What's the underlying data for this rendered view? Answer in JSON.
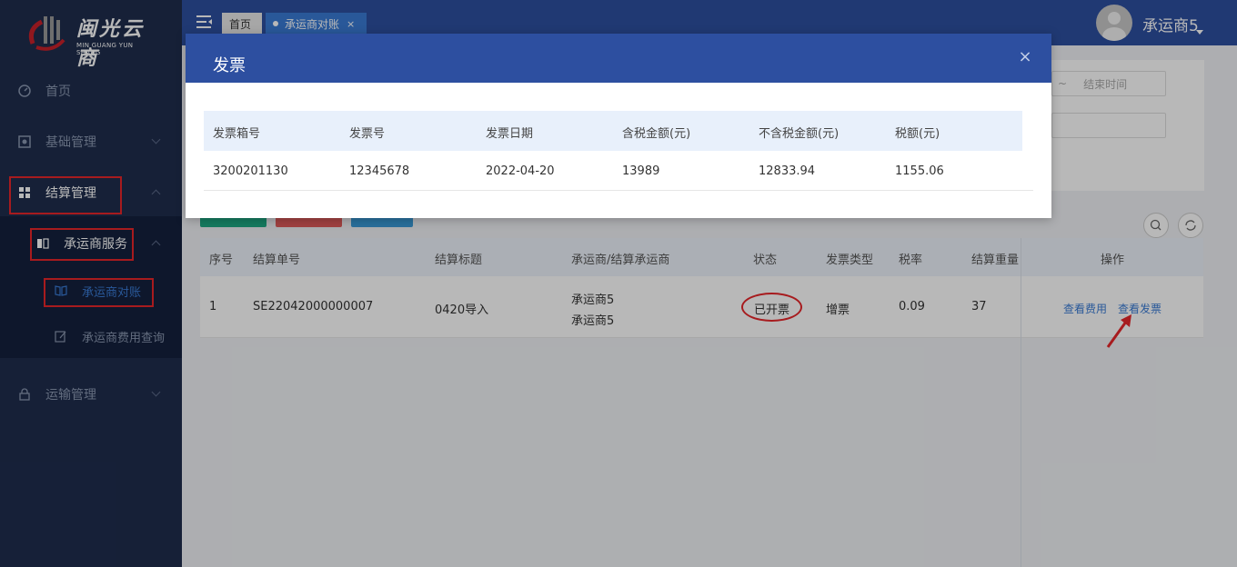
{
  "sidebar": {
    "logo_text": "闽光云商",
    "logo_sub": "MIN GUANG YUN SHANG",
    "items": [
      {
        "label": "首页"
      },
      {
        "label": "基础管理"
      },
      {
        "label": "结算管理"
      },
      {
        "label": "承运商服务"
      },
      {
        "label": "承运商对账"
      },
      {
        "label": "承运商费用查询"
      },
      {
        "label": "运输管理"
      }
    ]
  },
  "topbar": {
    "tabs": [
      {
        "label": "首页"
      },
      {
        "label": "承运商对账",
        "close": "×"
      }
    ],
    "user_name": "承运商5"
  },
  "filters": {
    "range_sep": "~",
    "end_placeholder": "结束时间"
  },
  "table": {
    "headers": [
      "序号",
      "结算单号",
      "结算标题",
      "承运商/结算承运商",
      "状态",
      "发票类型",
      "税率",
      "结算重量",
      "操作"
    ],
    "rows": [
      {
        "index": "1",
        "settle_no": "SE22042000000007",
        "title": "0420导入",
        "carrier": "承运商5",
        "settle_carrier": "承运商5",
        "status": "已开票",
        "invoice_type": "增票",
        "tax_rate": "0.09",
        "weight": "37",
        "action_fee": "查看费用",
        "action_invoice": "查看发票"
      }
    ]
  },
  "modal": {
    "title": "发票",
    "close": "×",
    "headers": [
      "发票箱号",
      "发票号",
      "发票日期",
      "含税金额(元)",
      "不含税金额(元)",
      "税额(元)"
    ],
    "rows": [
      {
        "box_no": "3200201130",
        "invoice_no": "12345678",
        "date": "2022-04-20",
        "amount_with_tax": "13989",
        "amount_without_tax": "12833.94",
        "tax": "1155.06"
      }
    ]
  },
  "colors": {
    "sidebar_bg": "#1f2d4d",
    "header_blue": "#2d4fa0",
    "highlight_red": "#e8262a",
    "link_blue": "#3a7bd5"
  }
}
